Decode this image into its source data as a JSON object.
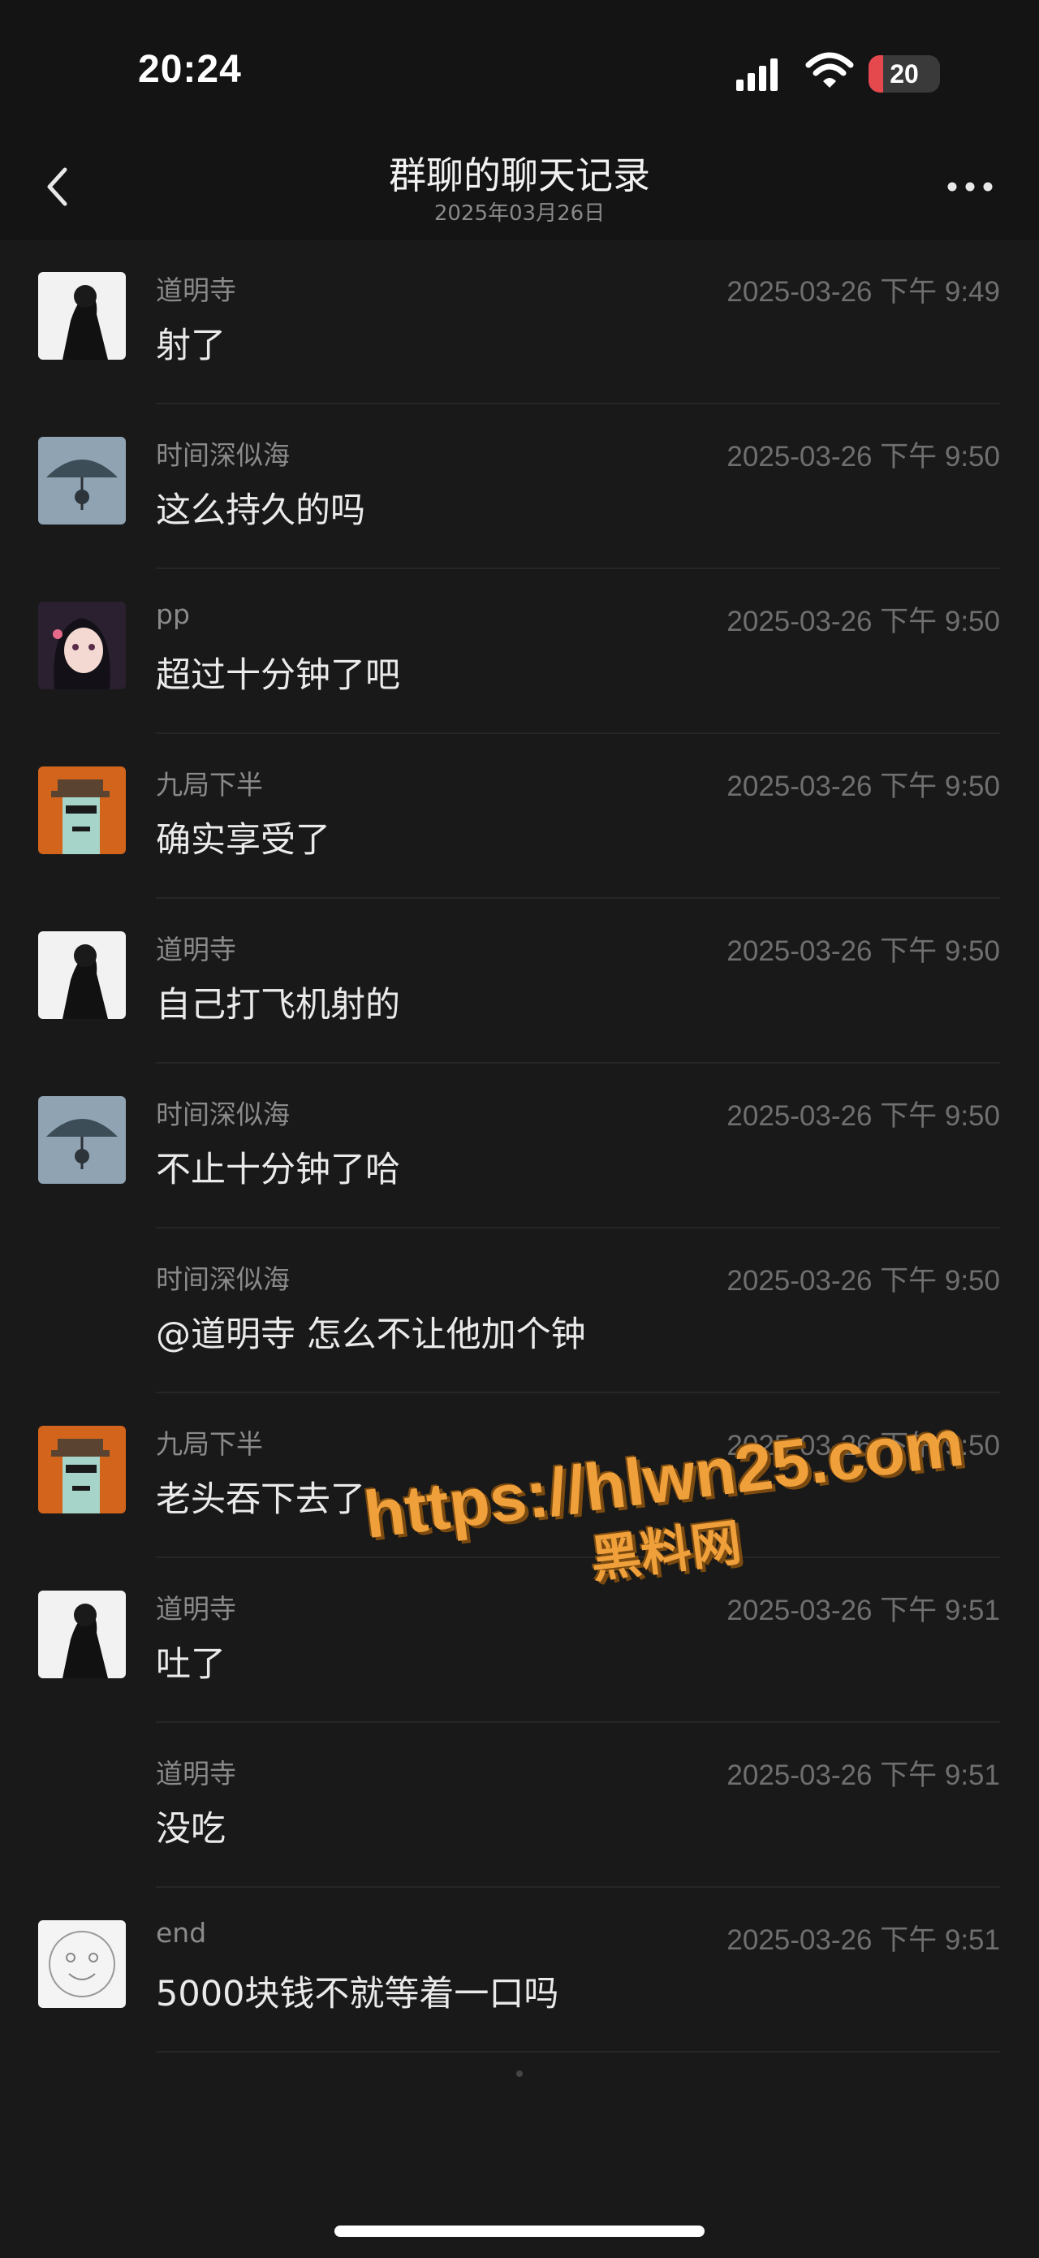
{
  "status_bar": {
    "time": "20:24",
    "battery": "20",
    "battery_level": 0.2
  },
  "nav": {
    "title": "群聊的聊天记录",
    "subtitle": "2025年03月26日"
  },
  "messages": [
    {
      "sender": "道明寺",
      "time": "2025-03-26 下午 9:49",
      "text": "射了",
      "avatar": "dark-figure"
    },
    {
      "sender": "时间深似海",
      "time": "2025-03-26 下午 9:50",
      "text": "这么持久的吗",
      "avatar": "umbrella"
    },
    {
      "sender": "pp",
      "time": "2025-03-26 下午 9:50",
      "text": "超过十分钟了吧",
      "avatar": "anime-girl"
    },
    {
      "sender": "九局下半",
      "time": "2025-03-26 下午 9:50",
      "text": "确实享受了",
      "avatar": "pixel-punk"
    },
    {
      "sender": "道明寺",
      "time": "2025-03-26 下午 9:50",
      "text": "自己打飞机射的",
      "avatar": "dark-figure"
    },
    {
      "sender": "时间深似海",
      "time": "2025-03-26 下午 9:50",
      "text": "不止十分钟了哈",
      "avatar": "umbrella"
    },
    {
      "sender": "时间深似海",
      "time": "2025-03-26 下午 9:50",
      "text": "@道明寺 怎么不让他加个钟",
      "avatar": "none"
    },
    {
      "sender": "九局下半",
      "time": "2025-03-26 下午 9:50",
      "text": "老头吞下去了",
      "avatar": "pixel-punk"
    },
    {
      "sender": "道明寺",
      "time": "2025-03-26 下午 9:51",
      "text": "吐了",
      "avatar": "dark-figure"
    },
    {
      "sender": "道明寺",
      "time": "2025-03-26 下午 9:51",
      "text": "没吃",
      "avatar": "none"
    },
    {
      "sender": "end",
      "time": "2025-03-26 下午 9:51",
      "text": "5000块钱不就等着一口吗",
      "avatar": "smiley"
    }
  ],
  "watermark": {
    "url": "https://hlwn25.com",
    "name": "黑料网"
  },
  "colors": {
    "background": "#191919",
    "watermark": "#f0a03a",
    "battery_low": "#e5484d"
  }
}
